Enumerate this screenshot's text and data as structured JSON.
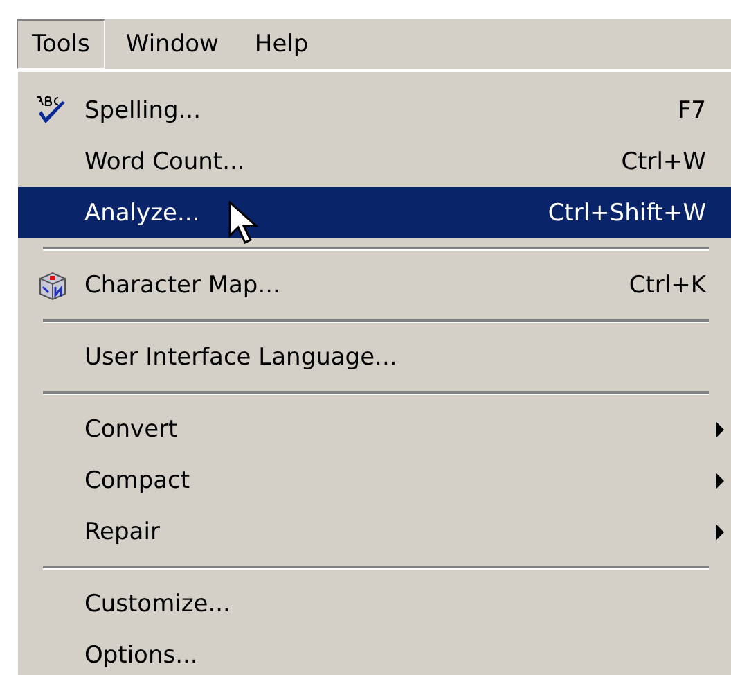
{
  "menubar": [
    {
      "label": "Tools",
      "selected": true
    },
    {
      "label": "Window",
      "selected": false
    },
    {
      "label": "Help",
      "selected": false
    }
  ],
  "menu": [
    {
      "kind": "command",
      "label": "Spelling...",
      "shortcut": "F7",
      "selected": false
    },
    {
      "kind": "command",
      "label": "Word Count...",
      "shortcut": "Ctrl+W",
      "selected": false
    },
    {
      "kind": "command",
      "label": "Analyze...",
      "shortcut": "Ctrl+Shift+W",
      "selected": true
    },
    {
      "kind": "separator"
    },
    {
      "kind": "command",
      "label": "Character Map...",
      "shortcut": "Ctrl+K",
      "selected": false
    },
    {
      "kind": "separator"
    },
    {
      "kind": "command",
      "label": "User Interface Language...",
      "selected": false
    },
    {
      "kind": "separator"
    },
    {
      "kind": "submenu",
      "label": "Convert",
      "selected": false
    },
    {
      "kind": "submenu",
      "label": "Compact",
      "selected": false
    },
    {
      "kind": "submenu",
      "label": "Repair",
      "selected": false
    },
    {
      "kind": "separator"
    },
    {
      "kind": "command",
      "label": "Customize...",
      "selected": false
    },
    {
      "kind": "command",
      "label": "Options...",
      "selected": false
    }
  ]
}
